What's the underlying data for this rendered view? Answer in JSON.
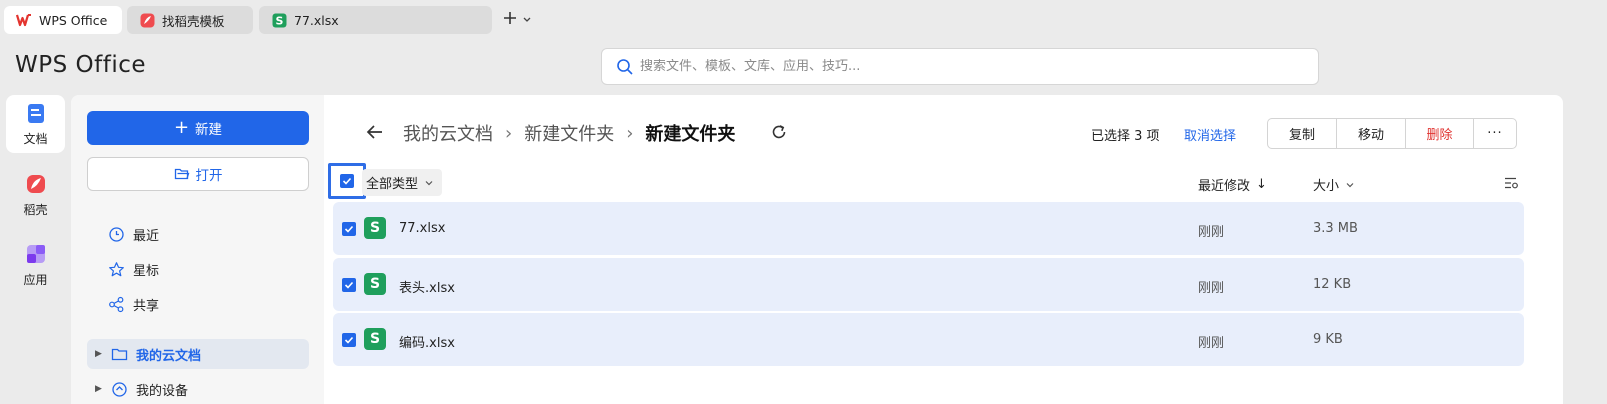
{
  "tabs": [
    {
      "label": "WPS Office",
      "icon": "wps-logo-icon"
    },
    {
      "label": "找稻壳模板",
      "icon": "docer-icon"
    },
    {
      "label": "77.xlsx",
      "icon": "spreadsheet-icon"
    }
  ],
  "header": {
    "logo": "WPS Office",
    "search_placeholder": "搜索文件、模板、文库、应用、技巧..."
  },
  "rail": [
    {
      "label": "文档",
      "icon": "docs-icon"
    },
    {
      "label": "稻壳",
      "icon": "docer-icon"
    },
    {
      "label": "应用",
      "icon": "apps-icon"
    }
  ],
  "sidebar": {
    "new_label": "新建",
    "open_label": "打开",
    "nav": [
      {
        "label": "最近",
        "icon": "clock-icon"
      },
      {
        "label": "星标",
        "icon": "star-icon"
      },
      {
        "label": "共享",
        "icon": "share-icon"
      }
    ],
    "cloud_label": "我的云文档",
    "device_label": "我的设备"
  },
  "toolbar": {
    "breadcrumb": [
      "我的云文档",
      "新建文件夹"
    ],
    "current_folder": "新建文件夹",
    "selected_count": "已选择 3 项",
    "cancel_selection": "取消选择",
    "copy": "复制",
    "move": "移动",
    "delete": "删除",
    "more": "···"
  },
  "table": {
    "type_filter": "全部类型",
    "col_modified": "最近修改",
    "col_modified_sort": "↓",
    "col_size": "大小",
    "rows": [
      {
        "name": "77.xlsx",
        "modified": "刚刚",
        "size": "3.3 MB",
        "icon_letter": "S"
      },
      {
        "name": "表头.xlsx",
        "modified": "刚刚",
        "size": "12 KB",
        "icon_letter": "S"
      },
      {
        "name": "编码.xlsx",
        "modified": "刚刚",
        "size": "9 KB",
        "icon_letter": "S"
      }
    ]
  },
  "colors": {
    "accent": "#2166e8",
    "danger": "#e0322f",
    "sheet_green": "#1f9f5c",
    "row_selected": "#e8eefb"
  }
}
